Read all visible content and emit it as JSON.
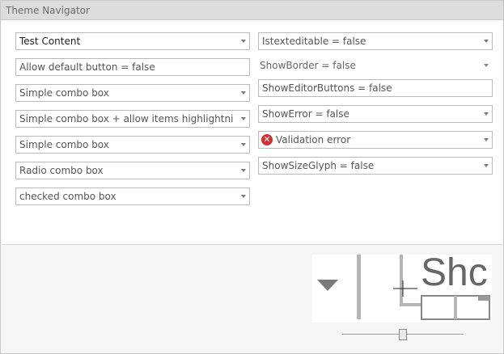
{
  "window": {
    "title": "Theme Navigator"
  },
  "left_column": [
    {
      "name": "test-content-combo",
      "text": "Test Content",
      "kind": "combo",
      "strong": true
    },
    {
      "name": "allow-default-button-field",
      "text": "Allow default button = false",
      "kind": "text"
    },
    {
      "name": "simple-combo-box-1",
      "text": "Simple combo box",
      "kind": "combo"
    },
    {
      "name": "simple-combo-highlighting",
      "text": "Simple combo box + allow items highlightning = false",
      "kind": "combo"
    },
    {
      "name": "simple-combo-box-2",
      "text": "Simple combo box",
      "kind": "combo"
    },
    {
      "name": "radio-combo-box",
      "text": "Radio combo box",
      "kind": "combo"
    },
    {
      "name": "checked-combo-box",
      "text": "checked combo box",
      "kind": "combo"
    }
  ],
  "right_column": [
    {
      "name": "istexteditable-combo",
      "text": "Istexteditable = false",
      "kind": "combo"
    },
    {
      "name": "showborder-combo",
      "text": "ShowBorder = false",
      "kind": "plain"
    },
    {
      "name": "showeditorbuttons-field",
      "text": "ShowEditorButtons = false",
      "kind": "text"
    },
    {
      "name": "showerror-combo",
      "text": "ShowError = false",
      "kind": "combo"
    },
    {
      "name": "validation-error-combo",
      "text": "Validation error",
      "kind": "error"
    },
    {
      "name": "showsizeglyph-combo",
      "text": "ShowSizeGlyph = false",
      "kind": "combo"
    }
  ],
  "preview": {
    "zoom_text": "Shc"
  },
  "slider": {
    "value": 0.5
  },
  "colors": {
    "error": "#d32f2f",
    "border": "#b9b9b9",
    "title_bg": "#dcdcdc"
  },
  "icons": {
    "error": "error-circle-icon",
    "dropdown": "chevron-down-icon"
  }
}
